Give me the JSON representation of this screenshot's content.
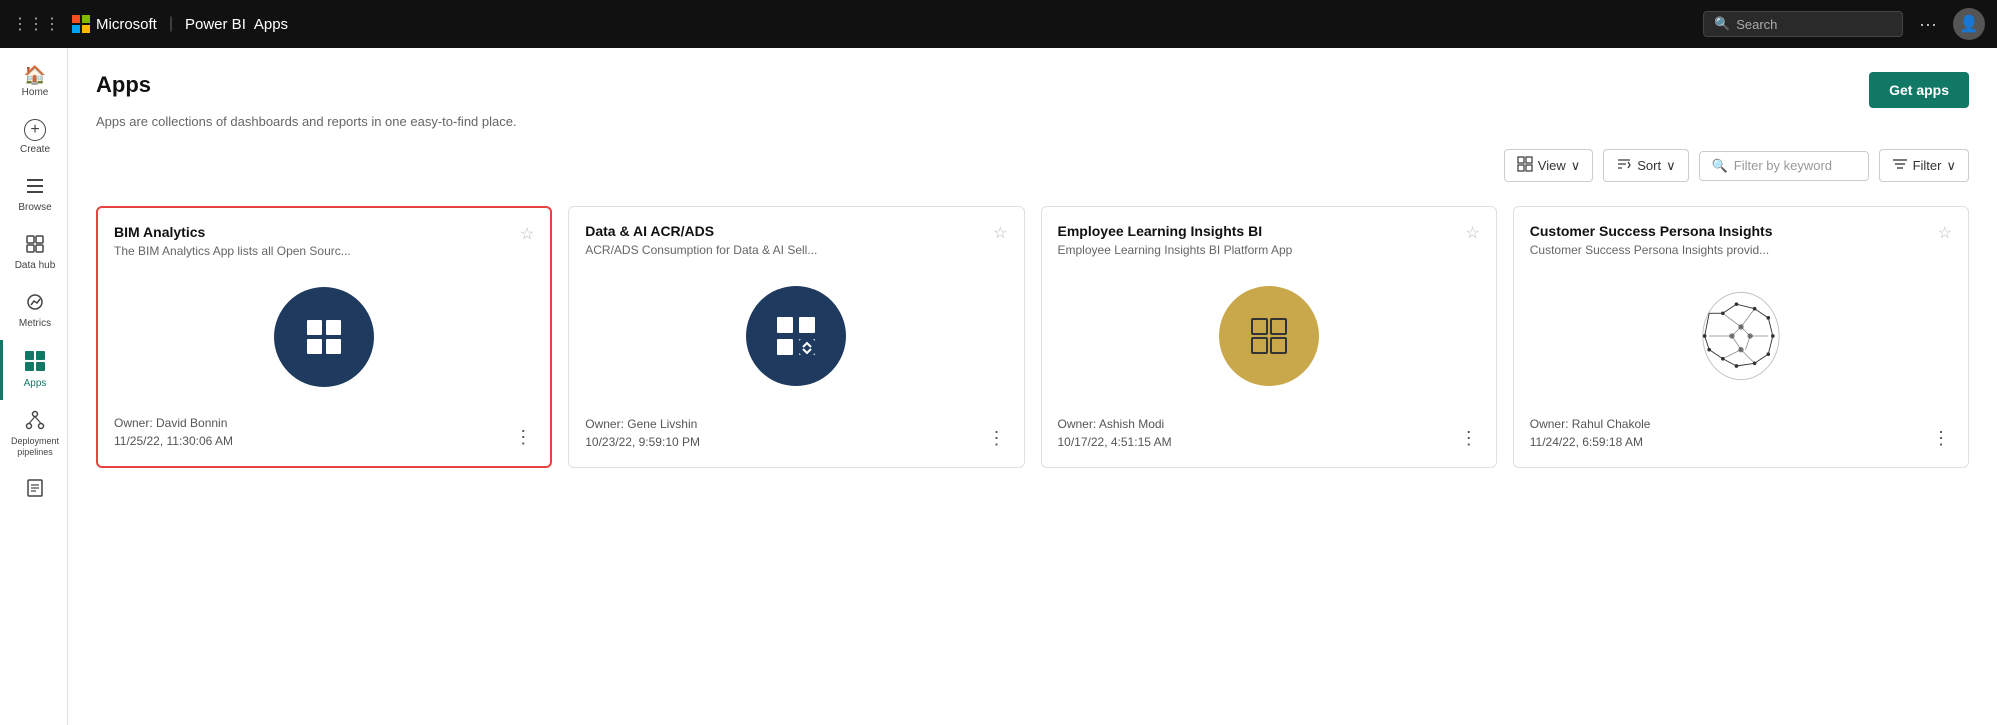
{
  "topnav": {
    "grid_label": "⋮⋮⋮",
    "brand": "Microsoft",
    "separator": "|",
    "product": "Power BI",
    "appname": "Apps",
    "search_placeholder": "Search",
    "more_icon": "···",
    "avatar_icon": "👤"
  },
  "sidebar": {
    "items": [
      {
        "id": "home",
        "label": "Home",
        "icon": "🏠",
        "active": false
      },
      {
        "id": "create",
        "label": "Create",
        "icon": "⊕",
        "active": false
      },
      {
        "id": "browse",
        "label": "Browse",
        "icon": "☰",
        "active": false
      },
      {
        "id": "datahub",
        "label": "Data hub",
        "icon": "⊡",
        "active": false
      },
      {
        "id": "metrics",
        "label": "Metrics",
        "icon": "📊",
        "active": false
      },
      {
        "id": "apps",
        "label": "Apps",
        "icon": "⊞",
        "active": true
      },
      {
        "id": "pipelines",
        "label": "Deployment pipelines",
        "icon": "⬡",
        "active": false
      },
      {
        "id": "book",
        "label": "Learn",
        "icon": "📖",
        "active": false
      }
    ]
  },
  "page": {
    "title": "Apps",
    "subtitle": "Apps are collections of dashboards and reports in one easy-to-find place.",
    "get_apps_label": "Get apps"
  },
  "toolbar": {
    "view_label": "View",
    "sort_label": "Sort",
    "filter_placeholder": "Filter by keyword",
    "filter_label": "Filter",
    "view_icon": "⊞",
    "sort_icon": "↕",
    "filter_search_icon": "🔍",
    "filter_menu_icon": "≡",
    "chevron": "∨"
  },
  "apps": [
    {
      "id": "bim-analytics",
      "title": "BIM Analytics",
      "subtitle": "The BIM Analytics App lists all Open Sourc...",
      "icon_type": "dark-blue",
      "icon_symbol": "grid",
      "owner": "Owner: David Bonnin",
      "date": "11/25/22, 11:30:06 AM",
      "highlighted": true
    },
    {
      "id": "data-ai",
      "title": "Data & AI ACR/ADS",
      "subtitle": "ACR/ADS Consumption for Data & AI Sell...",
      "icon_type": "dark-blue",
      "icon_symbol": "grid-diamond",
      "owner": "Owner: Gene Livshin",
      "date": "10/23/22, 9:59:10 PM",
      "highlighted": false
    },
    {
      "id": "employee-learning",
      "title": "Employee Learning Insights BI",
      "subtitle": "Employee Learning Insights BI Platform App",
      "icon_type": "gold",
      "icon_symbol": "grid",
      "owner": "Owner: Ashish Modi",
      "date": "10/17/22, 4:51:15 AM",
      "highlighted": false
    },
    {
      "id": "customer-success",
      "title": "Customer Success Persona Insights",
      "subtitle": "Customer Success Persona Insights provid...",
      "icon_type": "circuit",
      "icon_symbol": "circuit",
      "owner": "Owner: Rahul Chakole",
      "date": "11/24/22, 6:59:18 AM",
      "highlighted": false
    }
  ]
}
